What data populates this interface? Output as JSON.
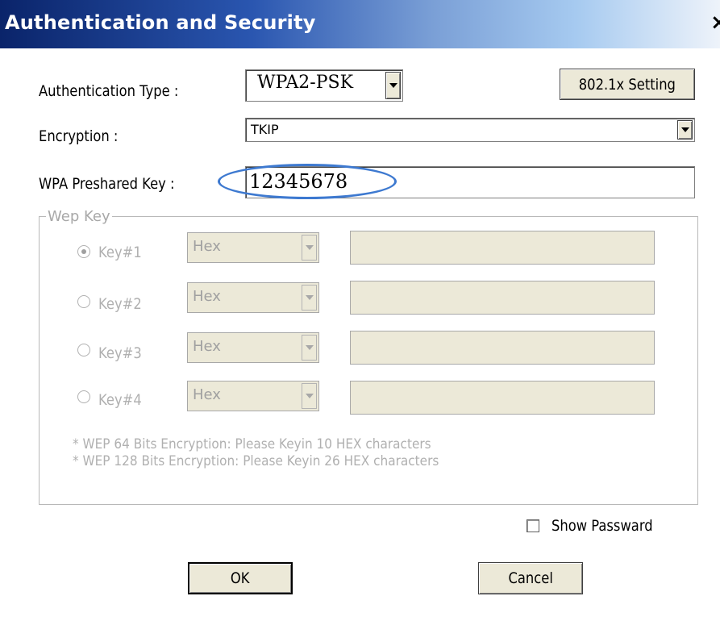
{
  "window": {
    "title": "Authentication and Security",
    "close_glyph": "×"
  },
  "auth": {
    "label": "Authentication Type :",
    "value": "WPA2-PSK",
    "setting_button": "802.1x Setting"
  },
  "encryption": {
    "label": "Encryption :",
    "value": "TKIP"
  },
  "psk": {
    "label": "WPA Preshared Key :",
    "value": "12345678",
    "highlight_color": "#3d79d0"
  },
  "wep": {
    "legend": "Wep Key",
    "keys": [
      {
        "label": "Key#1",
        "format": "Hex",
        "checked": true
      },
      {
        "label": "Key#2",
        "format": "Hex",
        "checked": false
      },
      {
        "label": "Key#3",
        "format": "Hex",
        "checked": false
      },
      {
        "label": "Key#4",
        "format": "Hex",
        "checked": false
      }
    ],
    "note_64": "* WEP 64 Bits Encryption:   Please Keyin 10 HEX characters",
    "note_128": "* WEP 128 Bits Encryption:   Please Keyin 26 HEX characters"
  },
  "show_password": {
    "label": "Show Passward",
    "checked": false
  },
  "buttons": {
    "ok": "OK",
    "cancel": "Cancel"
  }
}
